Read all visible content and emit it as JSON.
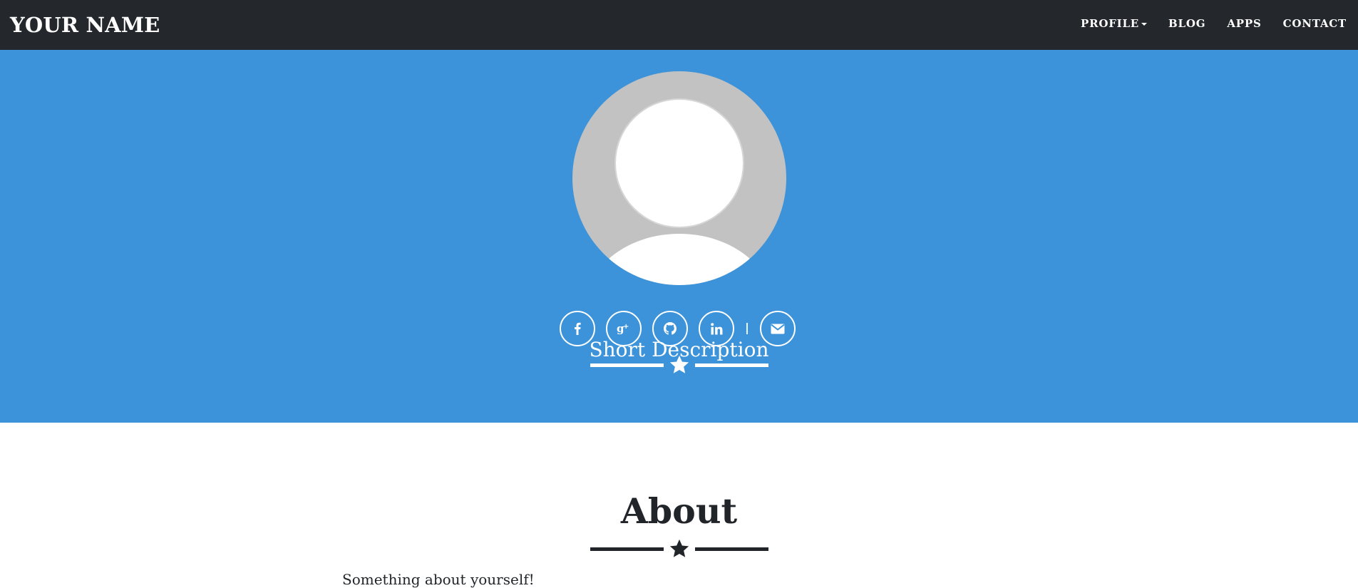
{
  "navbar": {
    "brand": "YOUR NAME",
    "items": [
      {
        "label": "PROFILE",
        "dropdown": true
      },
      {
        "label": "BLOG"
      },
      {
        "label": "APPS"
      },
      {
        "label": "CONTACT"
      }
    ]
  },
  "hero": {
    "avatar_icon": "default-user-avatar",
    "socials": [
      {
        "icon": "facebook-icon"
      },
      {
        "icon": "google-plus-icon"
      },
      {
        "icon": "github-icon"
      },
      {
        "icon": "linkedin-icon"
      },
      {
        "icon": "envelope-icon"
      }
    ],
    "short_description": "Short Description"
  },
  "about": {
    "title": "About",
    "text": "Something about yourself!"
  },
  "colors": {
    "navbar_bg": "#24282d",
    "hero_bg": "#3c93d9",
    "text_dark": "#212529",
    "white": "#ffffff"
  }
}
